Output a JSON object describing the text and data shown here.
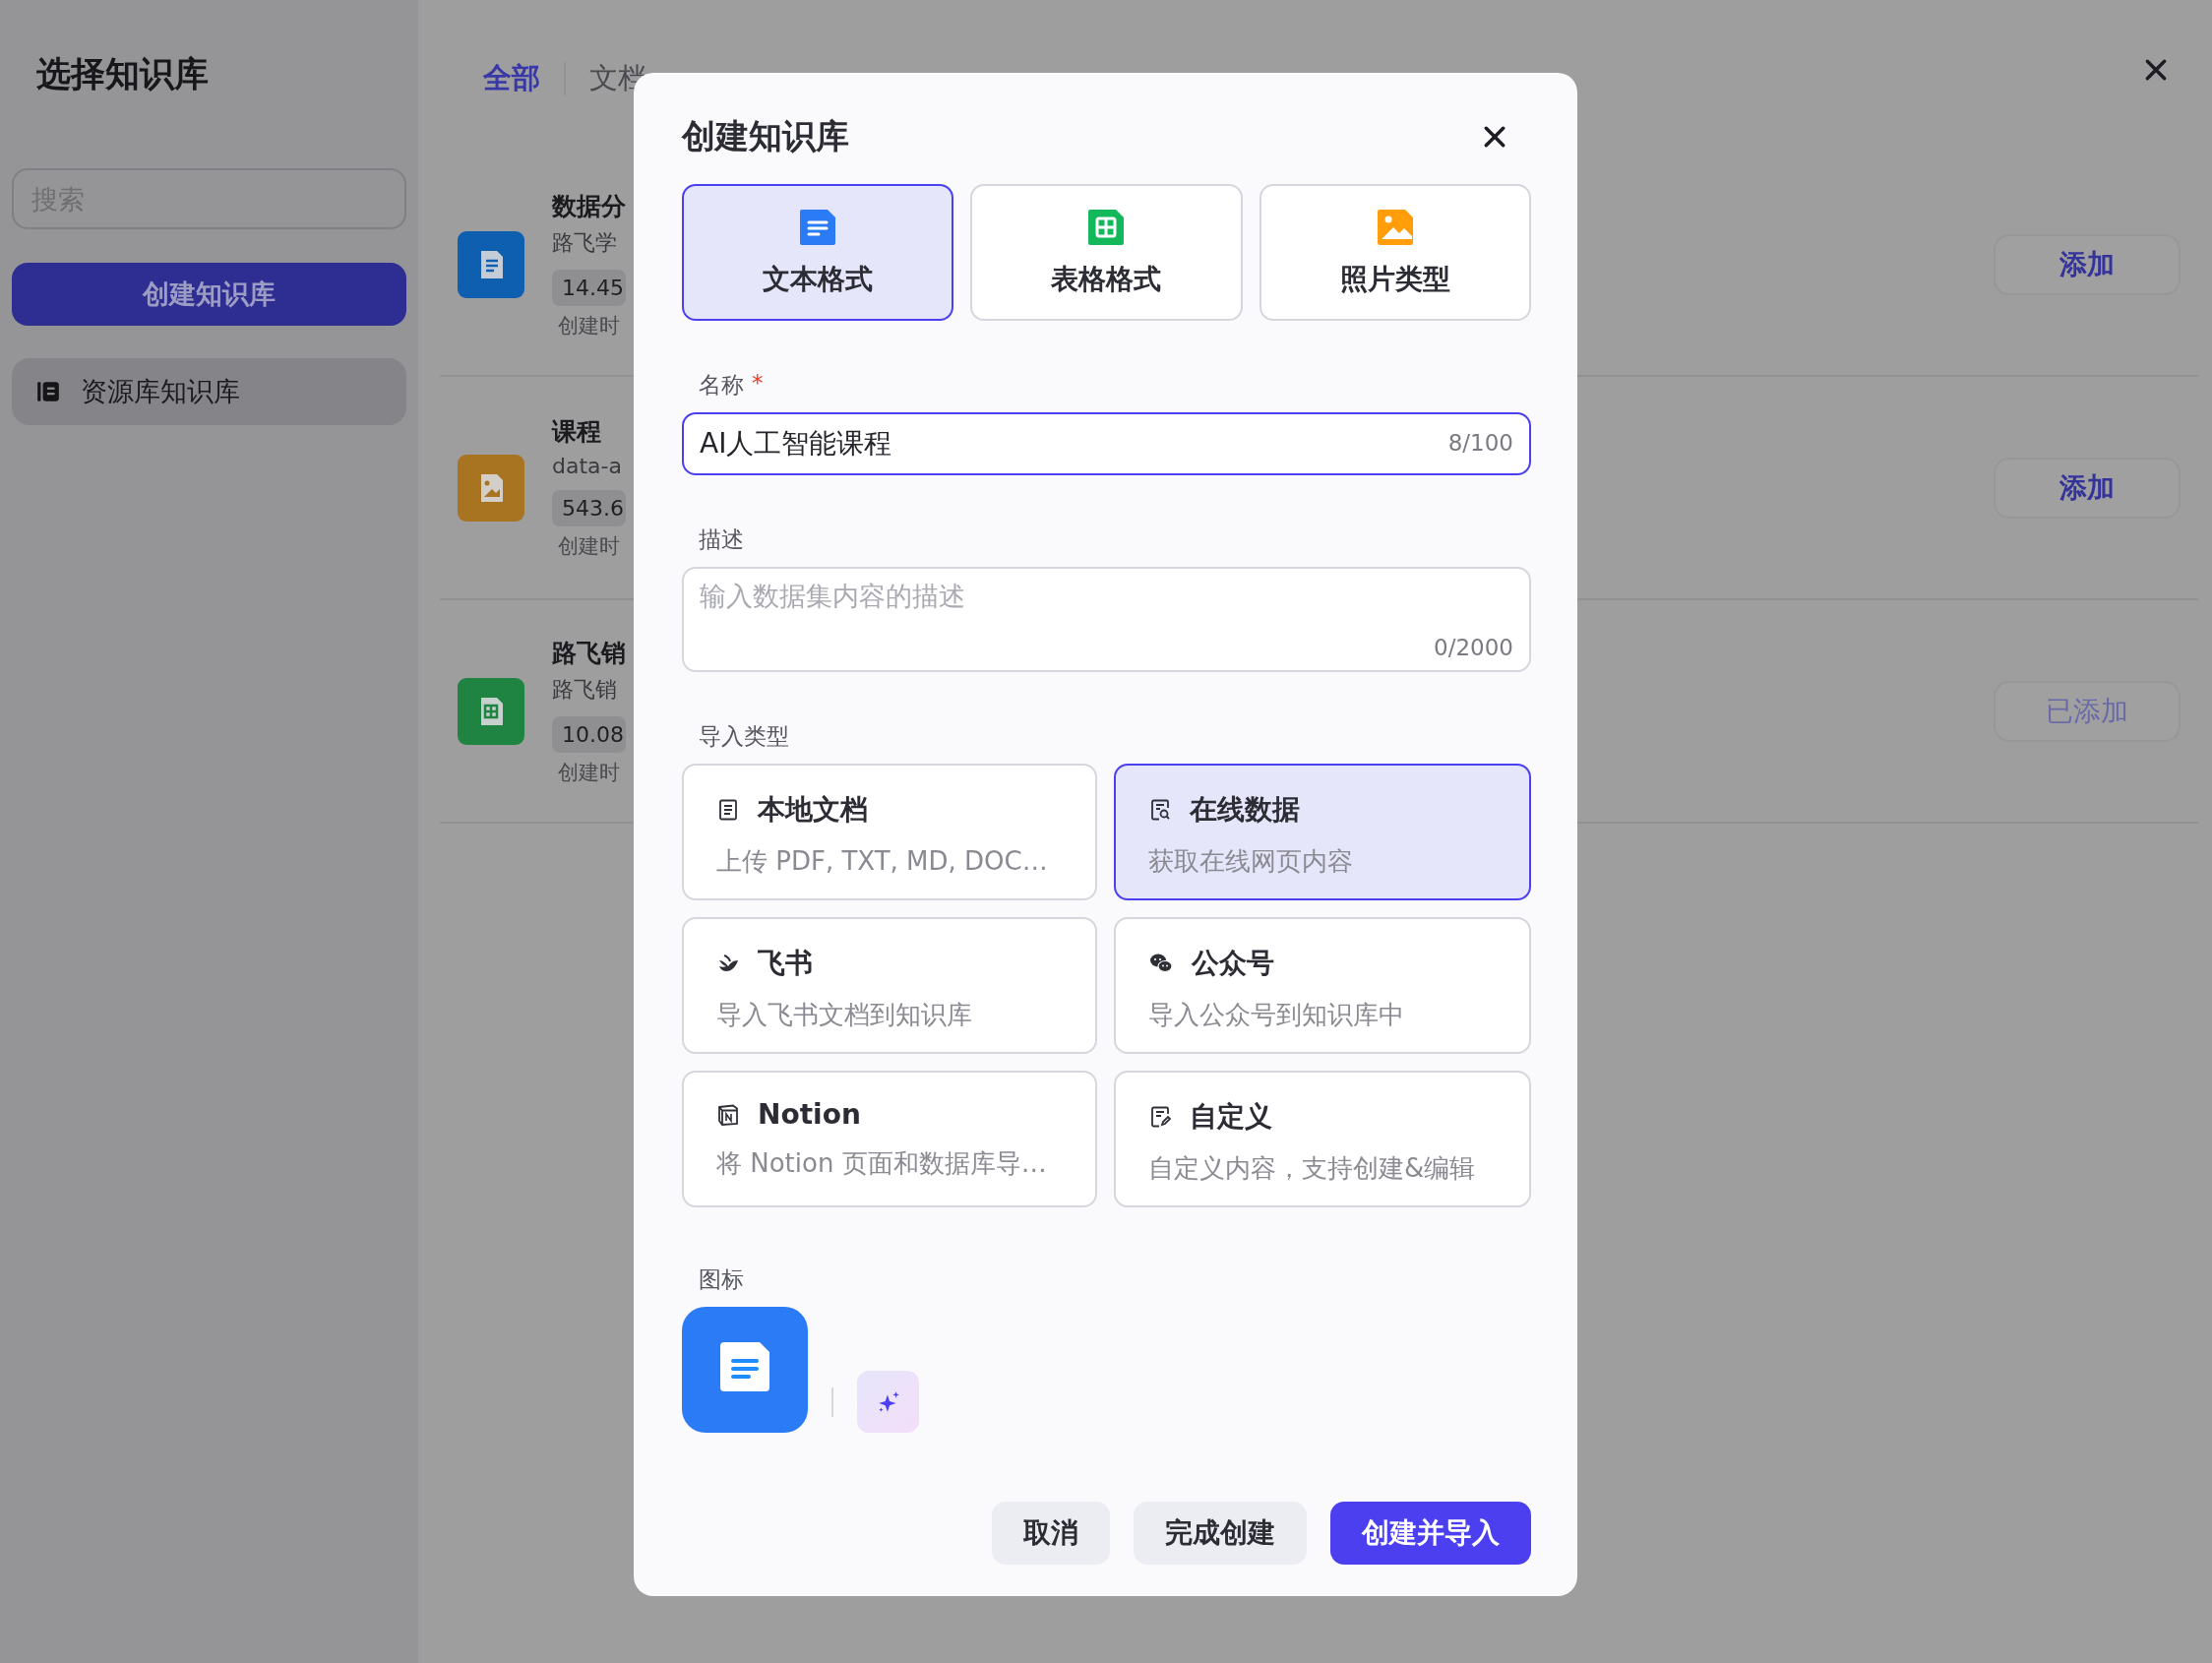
{
  "sidebar": {
    "title": "选择知识库",
    "search": {
      "placeholder": "搜索"
    },
    "create_button": "创建知识库",
    "items": [
      {
        "label": "资源库知识库",
        "selected": true
      }
    ]
  },
  "library": {
    "tabs": [
      {
        "label": "全部",
        "selected": true
      },
      {
        "label": "文档",
        "selected": false
      }
    ],
    "rows": [
      {
        "kind": "doc",
        "title": "数据分",
        "subtitle": "路飞学",
        "size": "14.45",
        "created": "创建时",
        "action": "添加",
        "added": false
      },
      {
        "kind": "image",
        "title": "课程",
        "subtitle": "data-a",
        "size": "543.6",
        "created": "创建时",
        "action": "添加",
        "added": false
      },
      {
        "kind": "sheet",
        "title": "路飞销",
        "subtitle": "路飞销",
        "size": "10.08",
        "created": "创建时",
        "action": "已添加",
        "added": true
      }
    ]
  },
  "dialog": {
    "title": "创建知识库",
    "formats": [
      {
        "kind": "doc",
        "label": "文本格式",
        "selected": true
      },
      {
        "kind": "sheet",
        "label": "表格格式",
        "selected": false
      },
      {
        "kind": "image",
        "label": "照片类型",
        "selected": false
      }
    ],
    "name": {
      "label": "名称",
      "required_mark": "*",
      "value": "AI人工智能课程",
      "counter": "8/100"
    },
    "description": {
      "label": "描述",
      "placeholder": "输入数据集内容的描述",
      "counter": "0/2000"
    },
    "import_types": {
      "label": "导入类型",
      "items": [
        {
          "kind": "local",
          "title": "本地文档",
          "subtitle": "上传 PDF, TXT, MD, DOC…",
          "selected": false
        },
        {
          "kind": "online",
          "title": "在线数据",
          "subtitle": "获取在线网页内容",
          "selected": true
        },
        {
          "kind": "feishu",
          "title": "飞书",
          "subtitle": "导入飞书文档到知识库",
          "selected": false
        },
        {
          "kind": "wechat",
          "title": "公众号",
          "subtitle": "导入公众号到知识库中",
          "selected": false
        },
        {
          "kind": "notion",
          "title": "Notion",
          "subtitle": "将 Notion 页面和数据库导…",
          "selected": false
        },
        {
          "kind": "custom",
          "title": "自定义",
          "subtitle": "自定义内容，支持创建&编辑",
          "selected": false
        }
      ]
    },
    "icon": {
      "label": "图标",
      "kind": "doc"
    },
    "buttons": [
      {
        "kind": "cancel",
        "label": "取消"
      },
      {
        "kind": "secondary",
        "label": "完成创建"
      },
      {
        "kind": "primary",
        "label": "创建并导入"
      }
    ]
  }
}
